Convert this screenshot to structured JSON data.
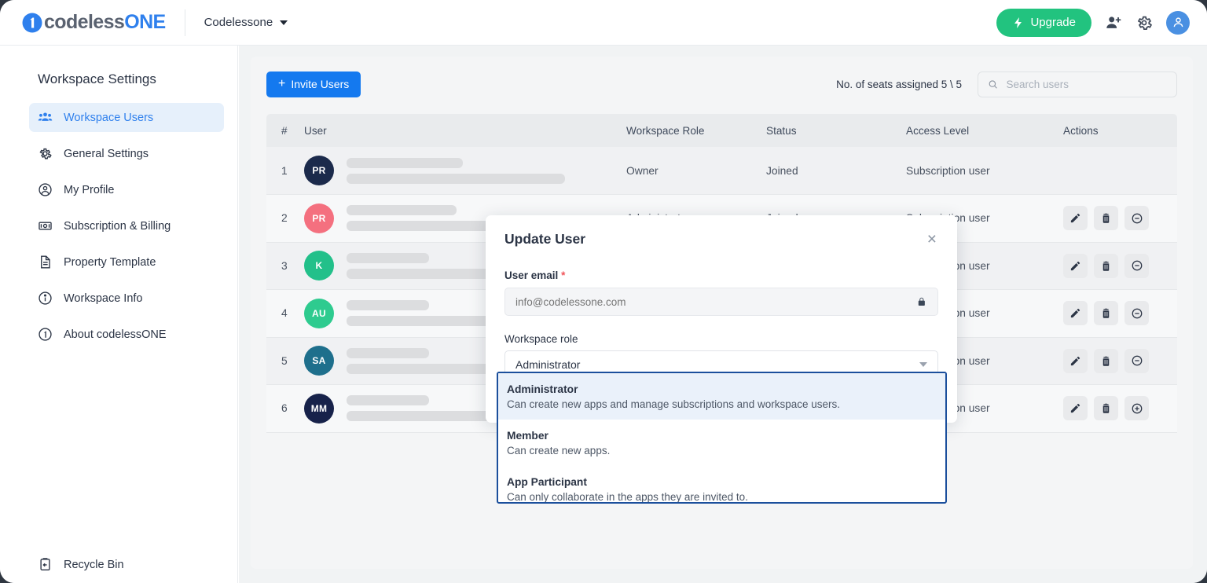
{
  "header": {
    "brand_prefix": "codeless",
    "brand_suffix": "ONE",
    "workspace_name": "Codelessone",
    "upgrade_label": "Upgrade",
    "icons": [
      "bolt-icon",
      "add-user-icon",
      "gear-icon",
      "user-avatar-icon"
    ]
  },
  "sidebar": {
    "title": "Workspace Settings",
    "items": [
      {
        "label": "Workspace Users",
        "icon": "users-icon",
        "active": true
      },
      {
        "label": "General Settings",
        "icon": "gear-icon",
        "active": false
      },
      {
        "label": "My Profile",
        "icon": "user-circle-icon",
        "active": false
      },
      {
        "label": "Subscription & Billing",
        "icon": "banknote-icon",
        "active": false
      },
      {
        "label": "Property Template",
        "icon": "document-icon",
        "active": false
      },
      {
        "label": "Workspace Info",
        "icon": "info-circle-icon",
        "active": false
      },
      {
        "label": "About codelessONE",
        "icon": "logo-circle-icon",
        "active": false
      }
    ],
    "recycle_bin": {
      "label": "Recycle Bin",
      "icon": "recycle-bin-icon"
    }
  },
  "toolbar": {
    "invite_label": "Invite Users",
    "seats_text": "No. of seats assigned 5 \\ 5",
    "search_placeholder": "Search users",
    "search_value": ""
  },
  "table": {
    "columns": [
      "#",
      "User",
      "Workspace Role",
      "Status",
      "Access Level",
      "Actions"
    ],
    "rows": [
      {
        "index": "1",
        "initials": "PR",
        "avatar_color": "#1b2a4b",
        "role": "Owner",
        "status": "Joined",
        "access": "Subscription user",
        "actions": []
      },
      {
        "index": "2",
        "initials": "PR",
        "avatar_color": "#f4707f",
        "role": "Administrator",
        "status": "Joined",
        "access": "Subscription user",
        "actions": [
          "edit-icon",
          "delete-icon",
          "minus-circle-icon"
        ]
      },
      {
        "index": "3",
        "initials": "K",
        "avatar_color": "#22c08a",
        "role": "",
        "status": "",
        "access": "Subscription user",
        "actions": [
          "edit-icon",
          "delete-icon",
          "minus-circle-icon"
        ]
      },
      {
        "index": "4",
        "initials": "AU",
        "avatar_color": "#2ecb8f",
        "role": "",
        "status": "",
        "access": "Subscription user",
        "actions": [
          "edit-icon",
          "delete-icon",
          "minus-circle-icon"
        ]
      },
      {
        "index": "5",
        "initials": "SA",
        "avatar_color": "#1e6f8c",
        "role": "",
        "status": "",
        "access": "Subscription user",
        "actions": [
          "edit-icon",
          "delete-icon",
          "minus-circle-icon"
        ]
      },
      {
        "index": "6",
        "initials": "MM",
        "avatar_color": "#17224a",
        "role": "",
        "status": "",
        "access": "Subscription user",
        "actions": [
          "edit-icon",
          "delete-icon",
          "plus-circle-icon"
        ]
      }
    ]
  },
  "modal": {
    "title": "Update User",
    "close_label": "×",
    "email_label": "User email",
    "required_mark": "*",
    "email_value": "info@codelessone.com",
    "email_placeholder": "info@codelessone.com",
    "lock_icon": "lock-icon",
    "role_label": "Workspace role",
    "role_selected": "Administrator"
  },
  "dropdown": {
    "options": [
      {
        "name": "Administrator",
        "desc": "Can create new apps and manage subscriptions and workspace users.",
        "selected": true
      },
      {
        "name": "Member",
        "desc": "Can create new apps.",
        "selected": false
      },
      {
        "name": "App Participant",
        "desc": "Can only collaborate in the apps they are invited to.",
        "selected": false
      }
    ]
  },
  "colors": {
    "primary_blue": "#1479ef",
    "accent_green": "#22c37f",
    "active_nav_bg": "#e6f0fb",
    "dropdown_border": "#1b4f9c"
  }
}
